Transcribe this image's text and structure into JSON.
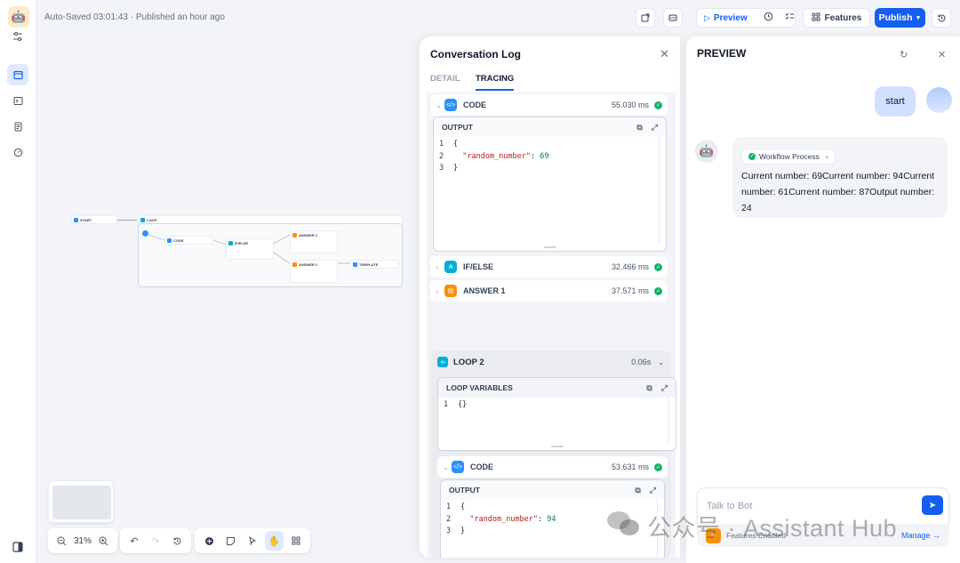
{
  "topbar": {
    "autosave": "Auto-Saved 03:01:43 · Published an hour ago",
    "preview_label": "Preview",
    "features_label": "Features",
    "publish_label": "Publish"
  },
  "canvas": {
    "nodes": {
      "start": "START",
      "loop": "LOOP",
      "code": "CODE",
      "ifelse": "IF/ELSE",
      "answer1": "ANSWER 1",
      "answer2": "ANSWER 2",
      "template": "TEMPLATE"
    },
    "zoom": "31%"
  },
  "log": {
    "title": "Conversation Log",
    "tabs": [
      "DETAIL",
      "TRACING"
    ],
    "active_tab": "TRACING",
    "rows": [
      {
        "name": "CODE",
        "time": "55.030 ms",
        "expanded": true
      },
      {
        "name": "IF/ELSE",
        "time": "32.466 ms",
        "expanded": false
      },
      {
        "name": "ANSWER 1",
        "time": "37.571 ms",
        "expanded": false
      }
    ],
    "output_label": "OUTPUT",
    "output1": {
      "key": "\"random_number\"",
      "value": "69"
    },
    "loop2": {
      "label": "LOOP 2",
      "time": "0.06s"
    },
    "loop_vars_label": "LOOP VARIABLES",
    "loop_vars_value": "{}",
    "row_code2": {
      "name": "CODE",
      "time": "53.631 ms"
    },
    "output2": {
      "key": "\"random_number\"",
      "value": "94"
    },
    "code_open": "{",
    "code_close": "}"
  },
  "preview": {
    "title": "PREVIEW",
    "user_message": "start",
    "workflow_label": "Workflow Process",
    "bot_message": "Current number: 69Current number: 94Current number: 61Current number: 87Output number: 24",
    "input_placeholder": "Talk to Bot",
    "features_enabled": "Features Enabled",
    "manage_label": "Manage"
  },
  "watermark": "公众号 · Assistant Hub",
  "colors": {
    "accent": "#155eef",
    "success": "#17b26a",
    "code_node": "#2e90fa",
    "ifelse_node": "#06aed4",
    "answer_node": "#f79009",
    "loop_node": "#06aed4"
  }
}
